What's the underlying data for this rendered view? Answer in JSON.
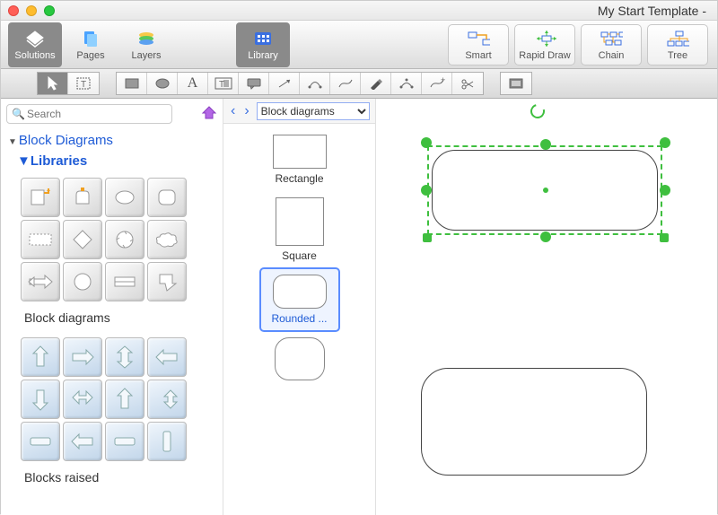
{
  "window": {
    "title": "My Start Template -"
  },
  "toolbar": {
    "solutions": "Solutions",
    "pages": "Pages",
    "layers": "Layers",
    "library": "Library",
    "smart": "Smart",
    "rapid": "Rapid Draw",
    "chain": "Chain",
    "tree": "Tree"
  },
  "search": {
    "placeholder": "Search"
  },
  "tree": {
    "root": "Block Diagrams",
    "sub": "Libraries",
    "lib1": "Block diagrams",
    "lib2": "Blocks raised"
  },
  "libpanel": {
    "selector": "Block diagrams",
    "shapes": {
      "rect": "Rectangle",
      "square": "Square",
      "rounded": "Rounded  ..."
    }
  }
}
